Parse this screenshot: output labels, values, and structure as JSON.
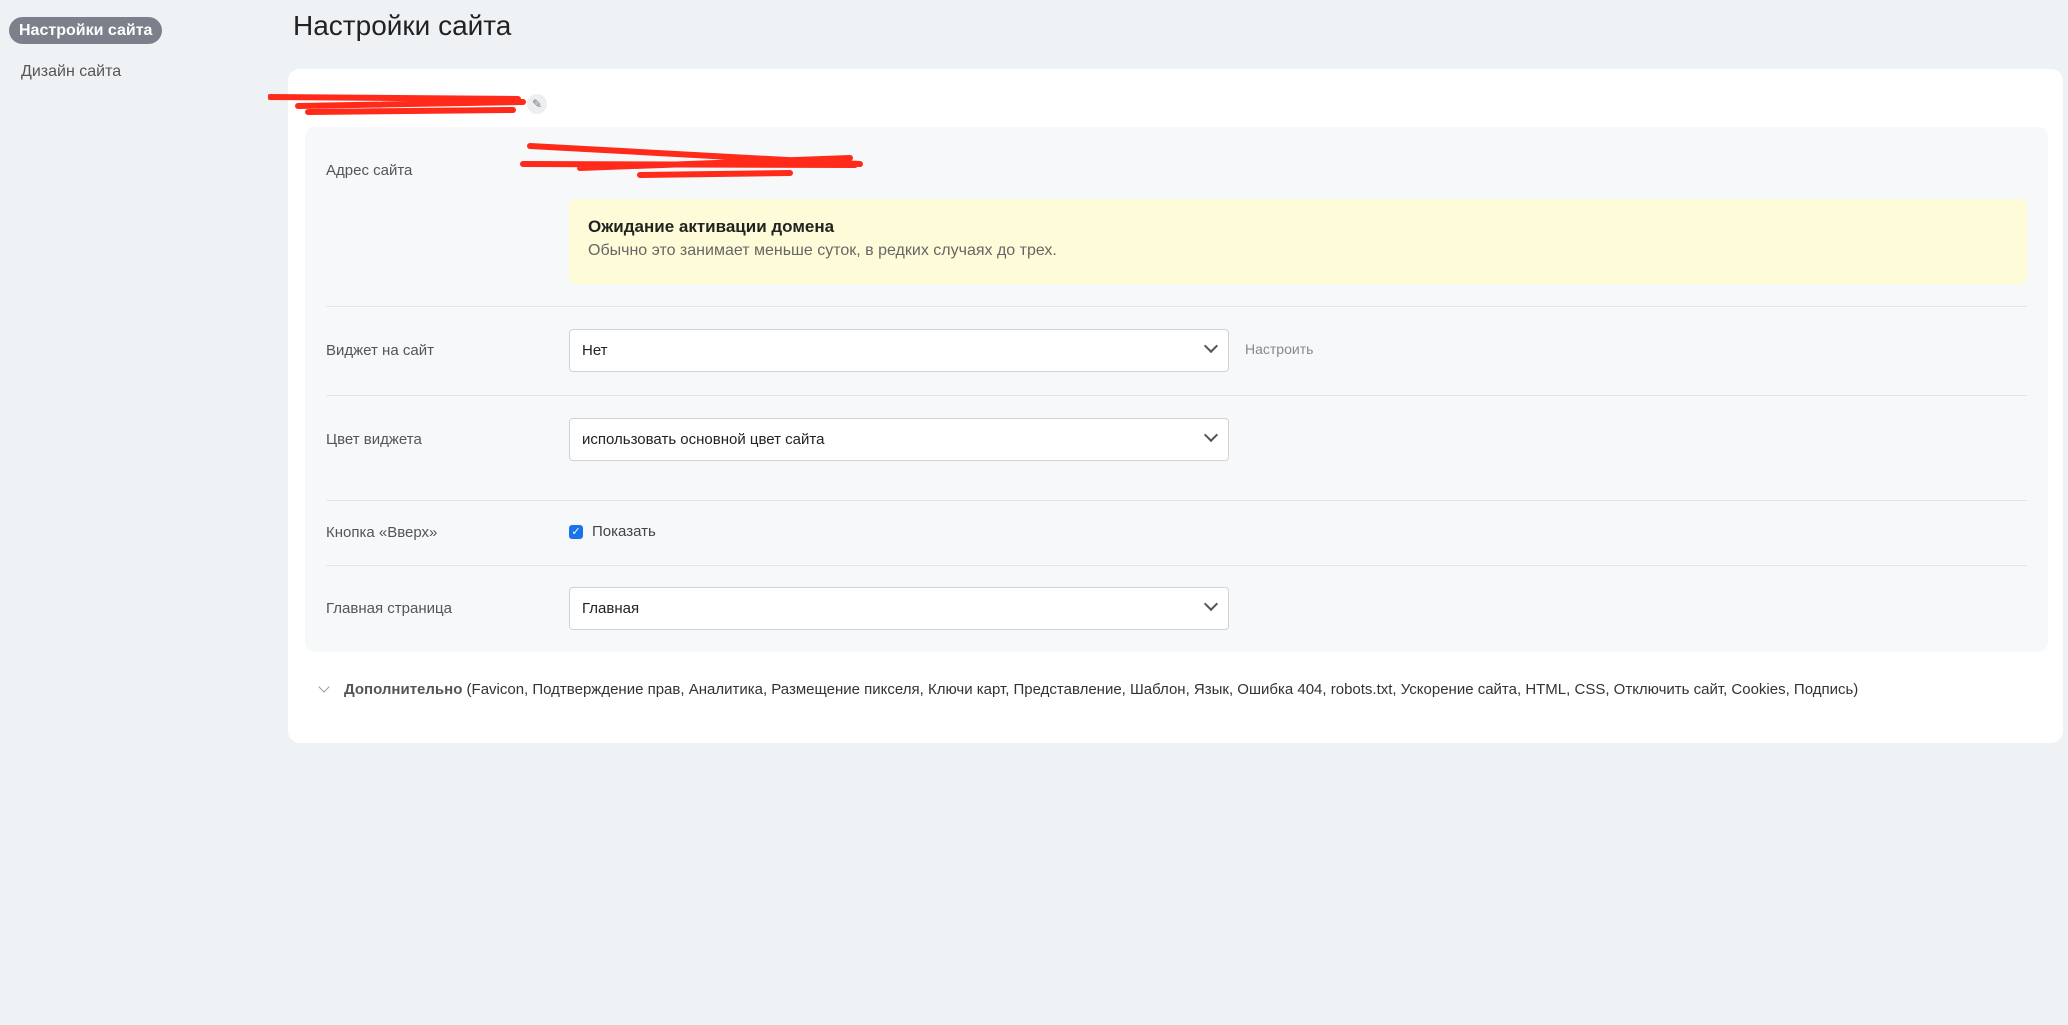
{
  "sidebar": {
    "items": [
      {
        "label": "Настройки сайта",
        "active": true
      },
      {
        "label": "Дизайн сайта"
      }
    ]
  },
  "page_title": "Настройки сайта",
  "form": {
    "address_label": "Адрес сайта",
    "notice": {
      "title": "Ожидание активации домена",
      "text": "Обычно это занимает меньше суток, в редких случаях до трех."
    },
    "widget_label": "Виджет на сайт",
    "widget_value": "Нет",
    "widget_configure": "Настроить",
    "color_label": "Цвет виджета",
    "color_value": "использовать основной цвет сайта",
    "up_label": "Кнопка «Вверх»",
    "up_checkbox_label": "Показать",
    "up_checked": true,
    "home_label": "Главная страница",
    "home_value": "Главная"
  },
  "advanced": {
    "label": "Дополнительно",
    "items": "(Favicon,  Подтверждение прав,  Аналитика,  Размещение пикселя,  Ключи карт,  Представление,  Шаблон,  Язык,  Ошибка 404,  robots.txt,  Ускорение сайта,  HTML,  CSS,  Отключить сайт,  Cookies,  Подпись)"
  },
  "colors": {
    "accent": "#1a73e8",
    "notice_bg": "#fefcd8",
    "redaction": "#ff2a1a"
  }
}
